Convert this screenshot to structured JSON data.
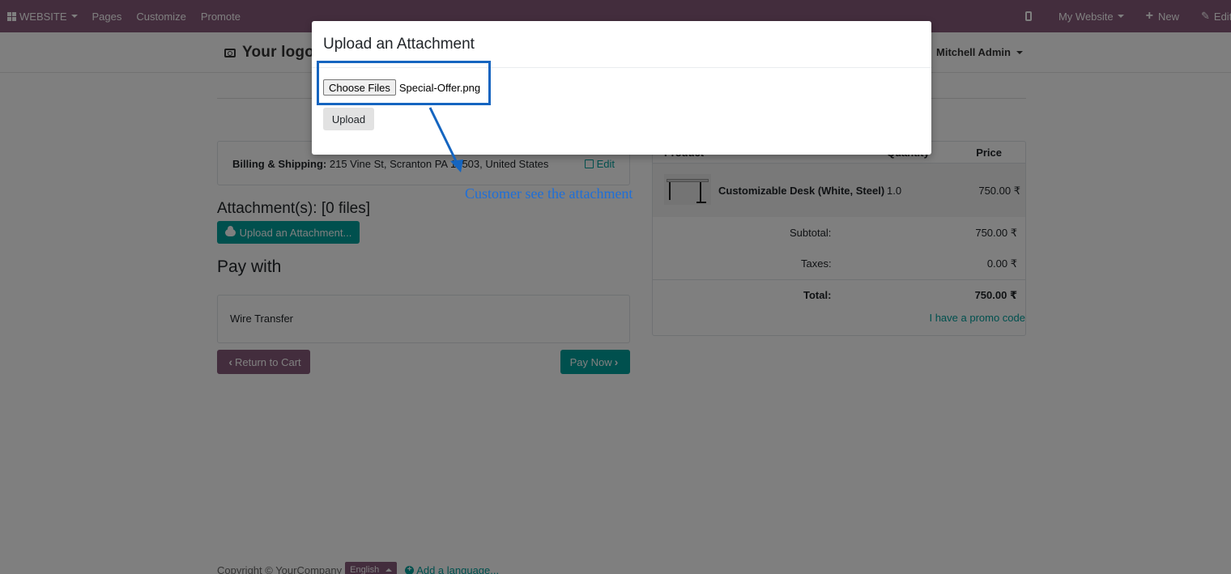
{
  "topbar": {
    "website_menu": "WEBSITE",
    "pages": "Pages",
    "customize": "Customize",
    "promote": "Promote",
    "my_website": "My Website",
    "new": "New",
    "edit": "Edit",
    "bg_color": "#875a7b"
  },
  "header": {
    "logo": "Your logo",
    "user": "Mitchell Admin"
  },
  "billing": {
    "label": "Billing & Shipping:",
    "address": " 215 Vine St, Scranton PA 18503, United States",
    "edit": "Edit"
  },
  "attachments": {
    "title": "Attachment(s): [0 files]",
    "upload_button": "Upload an Attachment..."
  },
  "payment": {
    "title": "Pay with",
    "method": "Wire Transfer",
    "return_button": "Return to Cart",
    "pay_button": "Pay Now"
  },
  "order": {
    "columns": [
      "Product",
      "Quantity",
      "Price"
    ],
    "items": [
      {
        "name": "Customizable Desk (White, Steel)",
        "quantity": "1.0",
        "price": "750.00 ₹"
      }
    ],
    "subtotal_label": "Subtotal:",
    "subtotal": "750.00 ₹",
    "taxes_label": "Taxes:",
    "taxes": "0.00 ₹",
    "total_label": "Total:",
    "total": "750.00 ₹",
    "promo": "I have a promo code"
  },
  "footer": {
    "copyright": "Copyright © YourCompany",
    "language": "English",
    "add_language": "Add a language..."
  },
  "modal": {
    "title": "Upload an Attachment",
    "choose_files": "Choose Files",
    "file_name": "Special-Offer.png",
    "upload": "Upload"
  },
  "annotation": {
    "text": "Customer see the attachment",
    "color": "#1565c0"
  },
  "colors": {
    "primary": "#00a09d",
    "secondary": "#875a7b"
  }
}
